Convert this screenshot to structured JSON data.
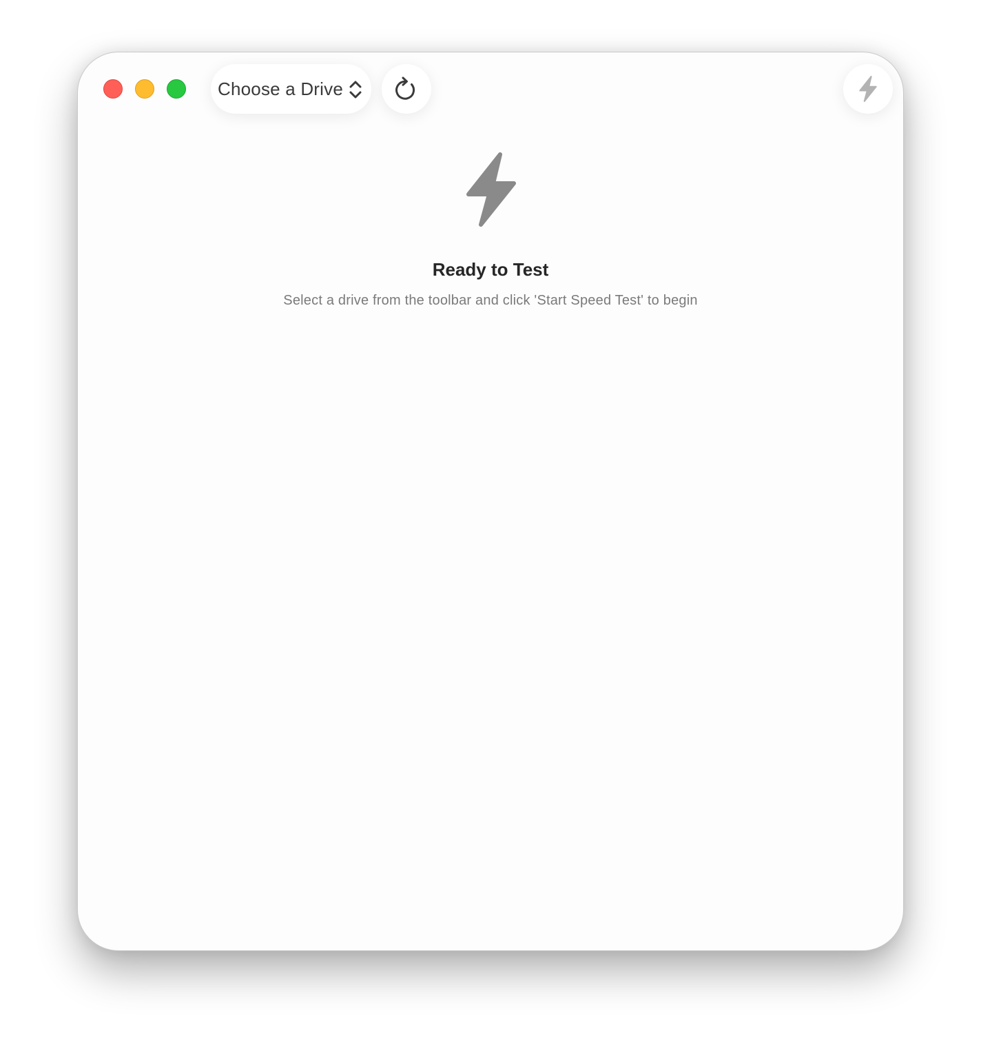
{
  "window": {
    "traffic_lights": {
      "close_color": "#ff5f57",
      "minimize_color": "#febc2e",
      "zoom_color": "#28c840"
    }
  },
  "toolbar": {
    "drive_picker_label": "Choose a Drive",
    "drive_picker_icon": "chevron-up-down-icon",
    "refresh_icon": "refresh-icon",
    "start_speed_test_icon": "bolt-icon"
  },
  "main": {
    "hero_icon": "bolt-icon",
    "title": "Ready to Test",
    "subtitle": "Select a drive from the toolbar and click 'Start Speed Test' to begin"
  },
  "colors": {
    "icon_gray": "#8a8a8a",
    "disabled_icon_gray": "#b3b3b3",
    "title_text": "#262626",
    "subtitle_text": "#7a7a7a"
  }
}
